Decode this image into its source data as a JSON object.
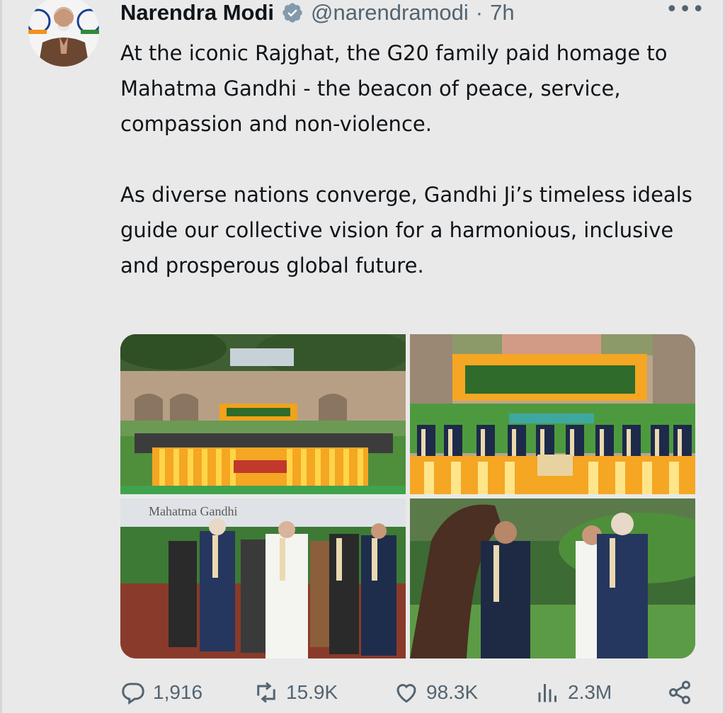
{
  "author": {
    "name": "Narendra Modi",
    "handle": "@narendramodi",
    "separator": "·",
    "time": "7h",
    "verified_icon": "verified-badge-icon"
  },
  "more_icon": "more-options-icon",
  "tweet": {
    "paragraph1": "At the iconic Rajghat, the G20 family paid homage to Mahatma Gandhi - the beacon of peace, service, compassion and non-violence.",
    "paragraph2": "As diverse nations converge, Gandhi Ji’s timeless ideals guide our collective vision for a harmonious, inclusive and prosperous global future."
  },
  "media": {
    "photos": [
      {
        "icon": "photo-rajghat-wide-view"
      },
      {
        "icon": "photo-leaders-at-memorial"
      },
      {
        "icon": "photo-leaders-walking",
        "sign_text": "Mahatma Gandhi"
      },
      {
        "icon": "photo-leaders-garden"
      }
    ]
  },
  "actions": {
    "reply": {
      "icon": "reply-icon",
      "count": "1,916"
    },
    "retweet": {
      "icon": "retweet-icon",
      "count": "15.9K"
    },
    "like": {
      "icon": "heart-icon",
      "count": "98.3K"
    },
    "views": {
      "icon": "views-chart-icon",
      "count": "2.3M"
    },
    "share": {
      "icon": "share-icon"
    }
  },
  "colors": {
    "verified": "#829aab",
    "text": "#0f1419",
    "secondary": "#536471",
    "background": "#e9e9e9"
  }
}
